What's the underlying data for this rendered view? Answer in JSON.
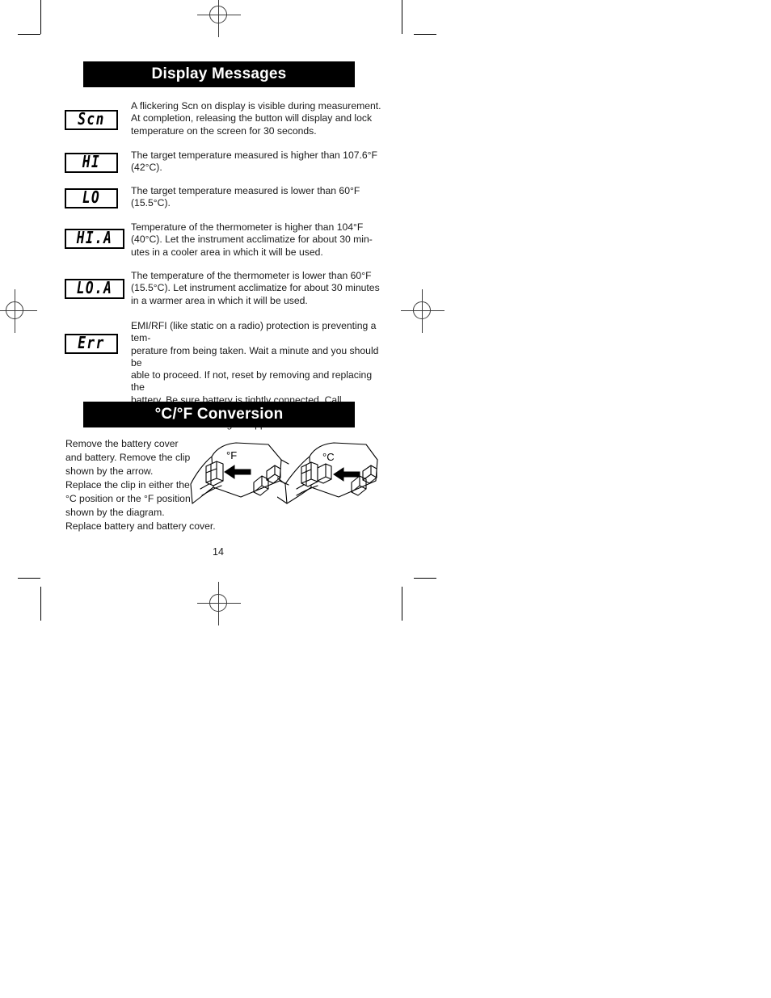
{
  "page": {
    "number": "14"
  },
  "sections": {
    "display_messages": {
      "title": "Display Messages"
    },
    "conversion": {
      "title": "°C/°F Conversion"
    }
  },
  "display_messages": [
    {
      "code": "Scn",
      "lines": [
        "A flickering Scn on display is visible during measurement.",
        "At completion, releasing the button will display and lock",
        "temperature on the screen for 30 seconds."
      ]
    },
    {
      "code": "HI",
      "lines": [
        "The target temperature measured is higher than 107.6°F",
        "(42°C)."
      ]
    },
    {
      "code": "LO",
      "lines": [
        "The target temperature measured is lower than 60°F",
        "(15.5°C)."
      ]
    },
    {
      "code": "HI.A",
      "lines": [
        "Temperature of the thermometer is higher than 104°F",
        "(40°C).  Let the instrument acclimatize for about 30 min-",
        "utes in a cooler area in which it will be used."
      ]
    },
    {
      "code": "LO.A",
      "lines": [
        "The temperature of the thermometer is lower than 60°F",
        "(15.5°C).  Let instrument acclimatize for about 30 minutes",
        "in a warmer area in which it will be used."
      ]
    },
    {
      "code": "Err",
      "lines": [
        "EMI/RFI (like static on a radio) protection is preventing a tem-",
        "perature from being taken.  Wait a minute and you should be",
        "able to proceed. If not, reset by removing and replacing the",
        "battery.  Be sure battery is tightly connected.  Call Customer",
        "Service if error message reappears."
      ]
    }
  ],
  "conversion": {
    "instruction_lines": [
      "Remove the battery cover",
      "and battery. Remove the clip",
      "shown by the arrow.",
      "Replace the clip in either the",
      "°C position or the °F position",
      "shown by the diagram.",
      "Replace battery and battery cover."
    ],
    "diagrams": [
      {
        "label": "°F"
      },
      {
        "label": "°C"
      }
    ]
  }
}
